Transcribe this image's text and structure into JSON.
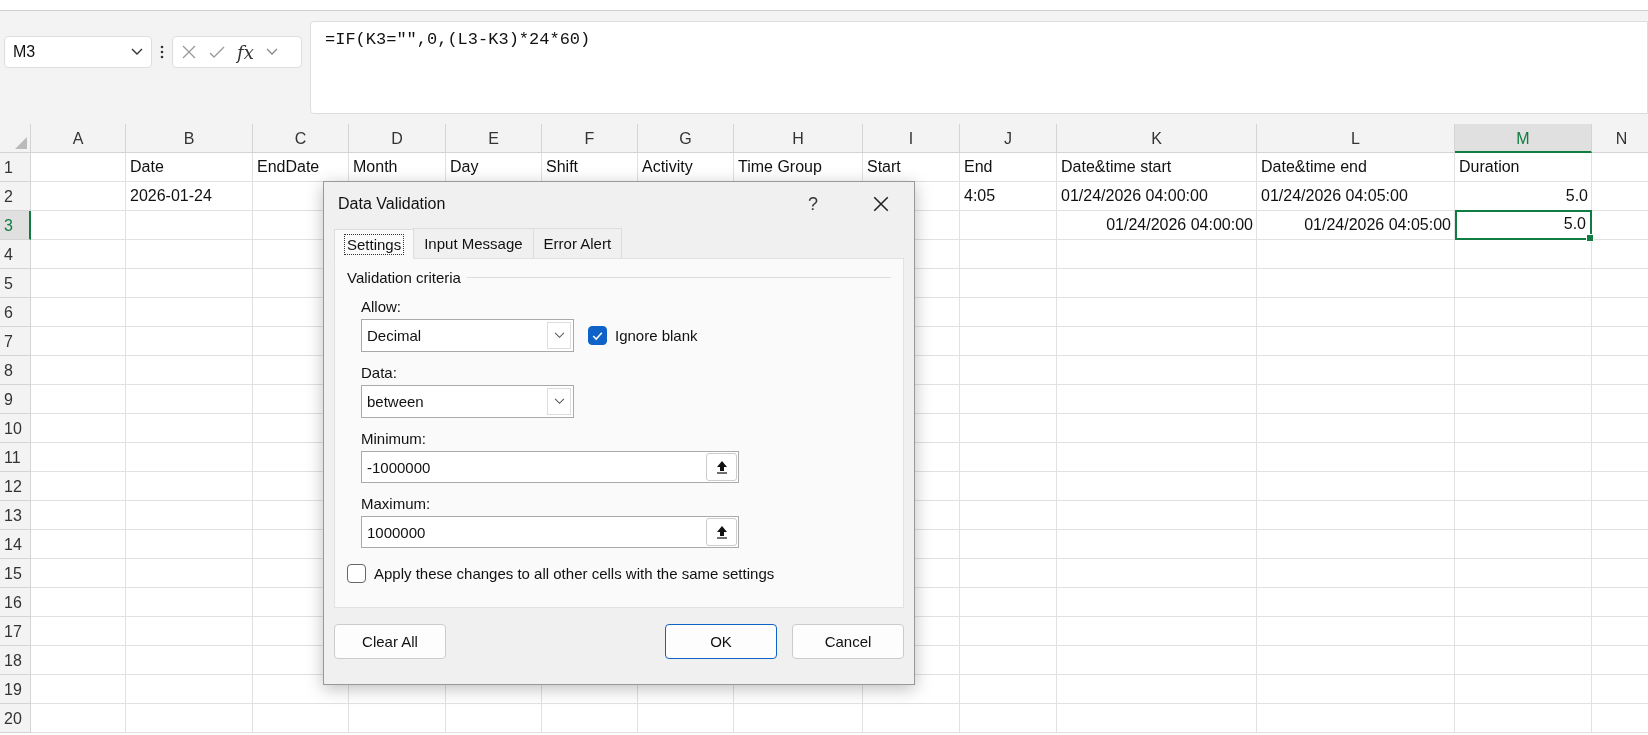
{
  "formula_bar": {
    "name_box": "M3",
    "function_label": "fx",
    "formula": "=IF(K3=\"\",0,(L3-K3)*24*60)"
  },
  "sheet": {
    "columns": [
      {
        "label": "A",
        "selected": false
      },
      {
        "label": "B",
        "selected": false
      },
      {
        "label": "C",
        "selected": false
      },
      {
        "label": "D",
        "selected": false
      },
      {
        "label": "E",
        "selected": false
      },
      {
        "label": "F",
        "selected": false
      },
      {
        "label": "G",
        "selected": false
      },
      {
        "label": "H",
        "selected": false
      },
      {
        "label": "I",
        "selected": false
      },
      {
        "label": "J",
        "selected": false
      },
      {
        "label": "K",
        "selected": false
      },
      {
        "label": "L",
        "selected": false
      },
      {
        "label": "M",
        "selected": true
      },
      {
        "label": "N",
        "selected": false
      }
    ],
    "rows": [
      {
        "label": "1",
        "selected": false,
        "cells": {
          "B": {
            "text": "Date",
            "kind": "text",
            "selected": false
          },
          "C": {
            "text": "EndDate",
            "kind": "text",
            "selected": false
          },
          "D": {
            "text": "Month",
            "kind": "text",
            "selected": false
          },
          "E": {
            "text": "Day",
            "kind": "text",
            "selected": false
          },
          "F": {
            "text": "Shift",
            "kind": "text",
            "selected": false
          },
          "G": {
            "text": "Activity",
            "kind": "text",
            "selected": false
          },
          "H": {
            "text": "Time Group",
            "kind": "text",
            "selected": false
          },
          "I": {
            "text": "Start",
            "kind": "text",
            "selected": false
          },
          "J": {
            "text": "End",
            "kind": "text",
            "selected": false
          },
          "K": {
            "text": "Date&time start",
            "kind": "text",
            "selected": false
          },
          "L": {
            "text": "Date&time end",
            "kind": "text",
            "selected": false
          },
          "M": {
            "text": "Duration",
            "kind": "text",
            "selected": false
          }
        }
      },
      {
        "label": "2",
        "selected": false,
        "cells": {
          "B": {
            "text": "2026-01-24",
            "kind": "text",
            "selected": false
          },
          "J": {
            "text": "4:05",
            "kind": "text",
            "selected": false
          },
          "K": {
            "text": "01/24/2026 04:00:00",
            "kind": "text",
            "selected": false
          },
          "L": {
            "text": "01/24/2026 04:05:00",
            "kind": "text",
            "selected": false
          },
          "M": {
            "text": "5.0",
            "kind": "number",
            "selected": false
          }
        }
      },
      {
        "label": "3",
        "selected": true,
        "cells": {
          "K": {
            "text": "01/24/2026 04:00:00",
            "kind": "number",
            "selected": false
          },
          "L": {
            "text": "01/24/2026 04:05:00",
            "kind": "number",
            "selected": false
          },
          "M": {
            "text": "5.0",
            "kind": "number",
            "selected": true
          }
        }
      },
      {
        "label": "4",
        "selected": false
      },
      {
        "label": "5",
        "selected": false
      },
      {
        "label": "6",
        "selected": false
      },
      {
        "label": "7",
        "selected": false
      },
      {
        "label": "8",
        "selected": false
      },
      {
        "label": "9",
        "selected": false
      },
      {
        "label": "10",
        "selected": false
      },
      {
        "label": "11",
        "selected": false
      },
      {
        "label": "12",
        "selected": false
      },
      {
        "label": "13",
        "selected": false
      },
      {
        "label": "14",
        "selected": false
      },
      {
        "label": "15",
        "selected": false
      },
      {
        "label": "16",
        "selected": false
      },
      {
        "label": "17",
        "selected": false
      },
      {
        "label": "18",
        "selected": false
      },
      {
        "label": "19",
        "selected": false
      },
      {
        "label": "20",
        "selected": false
      }
    ]
  },
  "dialog": {
    "title": "Data Validation",
    "help": "?",
    "tabs": [
      {
        "label": "Settings",
        "selected": true
      },
      {
        "label": "Input Message",
        "selected": false
      },
      {
        "label": "Error Alert",
        "selected": false
      }
    ],
    "group": "Validation criteria",
    "allow": {
      "label": "Allow:",
      "value": "Decimal"
    },
    "ignore_blank": {
      "label": "Ignore blank",
      "checked": true
    },
    "data": {
      "label": "Data:",
      "value": "between"
    },
    "minimum": {
      "label": "Minimum:",
      "value": "-1000000"
    },
    "maximum": {
      "label": "Maximum:",
      "value": "1000000"
    },
    "apply_all": {
      "label": "Apply these changes to all other cells with the same settings",
      "checked": false
    },
    "buttons": [
      {
        "label": "Clear All",
        "kind": "left"
      },
      {
        "label": "OK",
        "kind": "default"
      },
      {
        "label": "Cancel",
        "kind": "normal"
      }
    ]
  }
}
